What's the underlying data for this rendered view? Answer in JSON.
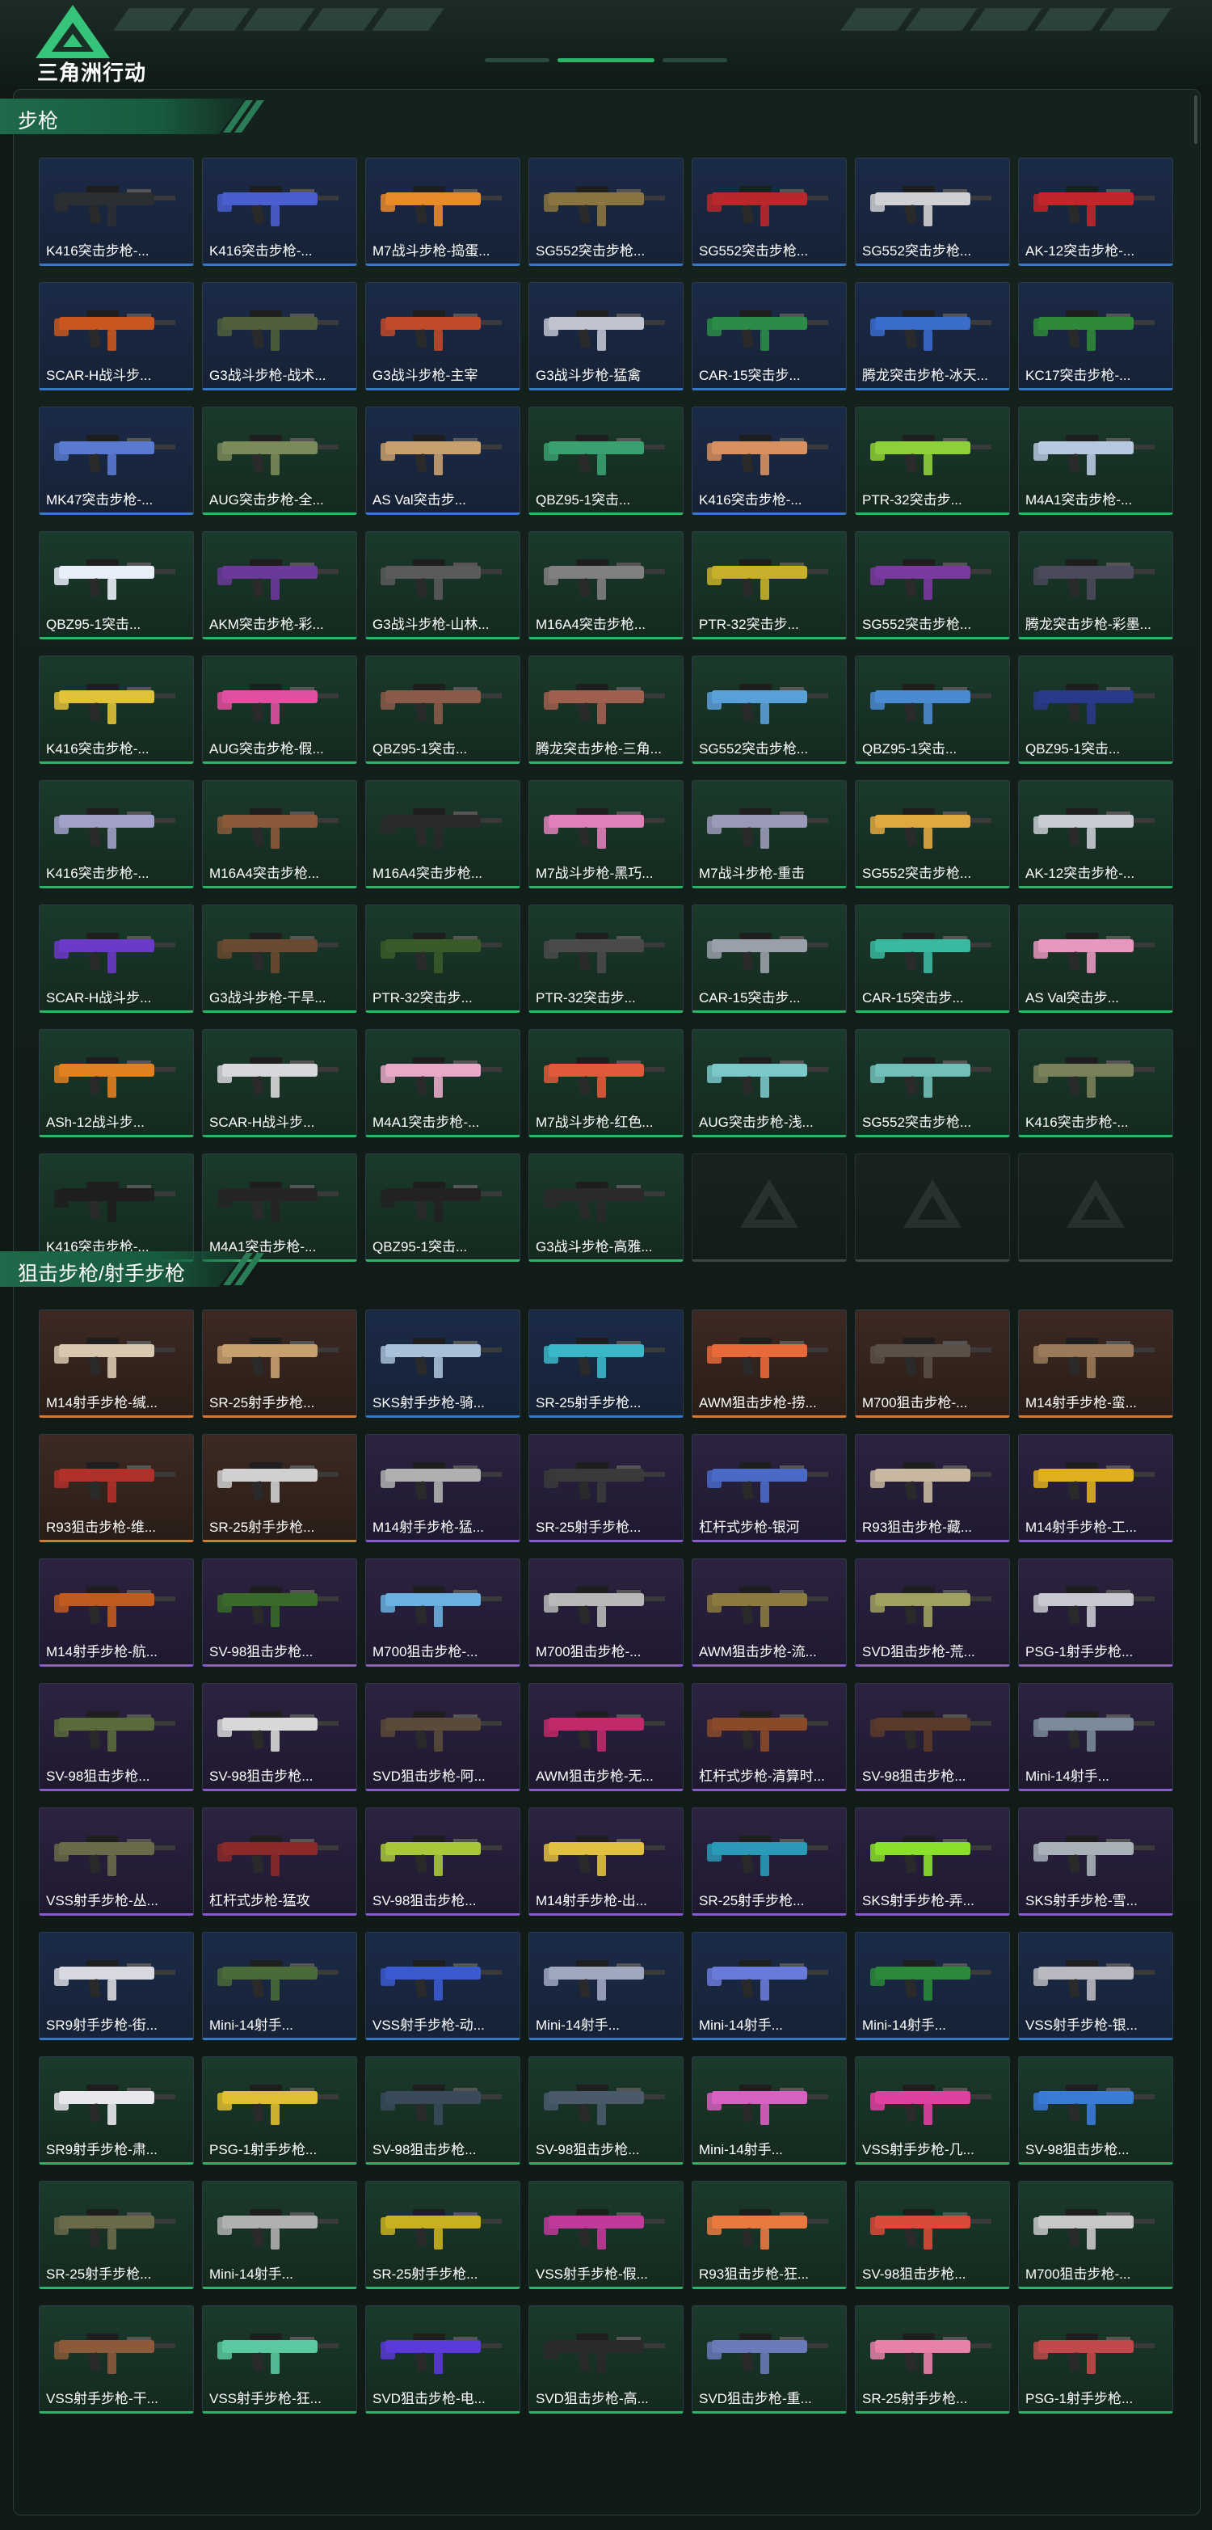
{
  "header": {
    "logo_text": "三角洲行动",
    "accent": "#2fb36a"
  },
  "sections": [
    {
      "title": "步枪",
      "items": [
        {
          "name": "K416突击步枪-...",
          "rarity": "blue",
          "color": "#2b2f33"
        },
        {
          "name": "K416突击步枪-...",
          "rarity": "blue",
          "color": "#4a5fcf"
        },
        {
          "name": "M7战斗步枪-捣蛋...",
          "rarity": "blue",
          "color": "#e88a2a"
        },
        {
          "name": "SG552突击步枪...",
          "rarity": "blue",
          "color": "#8a7440"
        },
        {
          "name": "SG552突击步枪...",
          "rarity": "blue",
          "color": "#b8282a"
        },
        {
          "name": "SG552突击步枪...",
          "rarity": "blue",
          "color": "#d0d0d4"
        },
        {
          "name": "AK-12突击步枪-...",
          "rarity": "blue",
          "color": "#c0262a"
        },
        {
          "name": "SCAR-H战斗步...",
          "rarity": "blue",
          "color": "#c8561e"
        },
        {
          "name": "G3战斗步枪-战术...",
          "rarity": "blue",
          "color": "#4f5f3c"
        },
        {
          "name": "G3战斗步枪-主宰",
          "rarity": "blue",
          "color": "#c04a2a"
        },
        {
          "name": "G3战斗步枪-猛禽",
          "rarity": "blue",
          "color": "#c0c4d0"
        },
        {
          "name": "CAR-15突击步...",
          "rarity": "blue",
          "color": "#2a8c48"
        },
        {
          "name": "腾龙突击步枪-冰天...",
          "rarity": "blue",
          "color": "#3a6ccc"
        },
        {
          "name": "KC17突击步枪-...",
          "rarity": "blue",
          "color": "#2e8a38"
        },
        {
          "name": "MK47突击步枪-...",
          "rarity": "blue",
          "color": "#5a7ad0"
        },
        {
          "name": "AUG突击步枪-全...",
          "rarity": "green",
          "color": "#7a8a5a"
        },
        {
          "name": "AS Val突击步...",
          "rarity": "blue",
          "color": "#c8a070"
        },
        {
          "name": "QBZ95-1突击...",
          "rarity": "green",
          "color": "#3aa070"
        },
        {
          "name": "K416突击步枪-...",
          "rarity": "blue",
          "color": "#d89060"
        },
        {
          "name": "PTR-32突击步...",
          "rarity": "green",
          "color": "#8ed03a"
        },
        {
          "name": "M4A1突击步枪-...",
          "rarity": "green",
          "color": "#b8c8e0"
        },
        {
          "name": "QBZ95-1突击...",
          "rarity": "green",
          "color": "#e8eef8"
        },
        {
          "name": "AKM突击步枪-彩...",
          "rarity": "green",
          "color": "#6a3a9a"
        },
        {
          "name": "G3战斗步枪-山林...",
          "rarity": "green",
          "color": "#5a5a5a"
        },
        {
          "name": "M16A4突击步枪...",
          "rarity": "green",
          "color": "#808080"
        },
        {
          "name": "PTR-32突击步...",
          "rarity": "green",
          "color": "#c8b02a"
        },
        {
          "name": "SG552突击步枪...",
          "rarity": "green",
          "color": "#7a3aa0"
        },
        {
          "name": "腾龙突击步枪-彩墨...",
          "rarity": "green",
          "color": "#4a4a5a"
        },
        {
          "name": "K416突击步枪-...",
          "rarity": "green",
          "color": "#e0c23a"
        },
        {
          "name": "AUG突击步枪-假...",
          "rarity": "green",
          "color": "#e050a0"
        },
        {
          "name": "QBZ95-1突击...",
          "rarity": "green",
          "color": "#8a5a4a"
        },
        {
          "name": "腾龙突击步枪-三角...",
          "rarity": "green",
          "color": "#a06050"
        },
        {
          "name": "SG552突击步枪...",
          "rarity": "green",
          "color": "#5aa0d8"
        },
        {
          "name": "QBZ95-1突击...",
          "rarity": "green",
          "color": "#4a8ad0"
        },
        {
          "name": "QBZ95-1突击...",
          "rarity": "green",
          "color": "#2a3a8a"
        },
        {
          "name": "K416突击步枪-...",
          "rarity": "green",
          "color": "#a0a0c8"
        },
        {
          "name": "M16A4突击步枪...",
          "rarity": "green",
          "color": "#8a5a3a"
        },
        {
          "name": "M16A4突击步枪...",
          "rarity": "green",
          "color": "#2a2a2a"
        },
        {
          "name": "M7战斗步枪-黑巧...",
          "rarity": "green",
          "color": "#e080b8"
        },
        {
          "name": "M7战斗步枪-重击",
          "rarity": "green",
          "color": "#9a9ab8"
        },
        {
          "name": "SG552突击步枪...",
          "rarity": "green",
          "color": "#e0a840"
        },
        {
          "name": "AK-12突击步枪-...",
          "rarity": "green",
          "color": "#c8ccd4"
        },
        {
          "name": "SCAR-H战斗步...",
          "rarity": "green",
          "color": "#6a3ac8"
        },
        {
          "name": "G3战斗步枪-干旱...",
          "rarity": "green",
          "color": "#6a4a30"
        },
        {
          "name": "PTR-32突击步...",
          "rarity": "green",
          "color": "#3a5a2a"
        },
        {
          "name": "PTR-32突击步...",
          "rarity": "green",
          "color": "#4a4a4a"
        },
        {
          "name": "CAR-15突击步...",
          "rarity": "green",
          "color": "#9aa0aa"
        },
        {
          "name": "CAR-15突击步...",
          "rarity": "green",
          "color": "#3ab8a0"
        },
        {
          "name": "AS Val突击步...",
          "rarity": "green",
          "color": "#e898c0"
        },
        {
          "name": "ASh-12战斗步...",
          "rarity": "green",
          "color": "#e08020"
        },
        {
          "name": "SCAR-H战斗步...",
          "rarity": "green",
          "color": "#d8d8dc"
        },
        {
          "name": "M4A1突击步枪-...",
          "rarity": "green",
          "color": "#e8a8c8"
        },
        {
          "name": "M7战斗步枪-红色...",
          "rarity": "green",
          "color": "#e05a3a"
        },
        {
          "name": "AUG突击步枪-浅...",
          "rarity": "green",
          "color": "#7ac8c8"
        },
        {
          "name": "SG552突击步枪...",
          "rarity": "green",
          "color": "#70c0b8"
        },
        {
          "name": "K416突击步枪-...",
          "rarity": "green",
          "color": "#7a805a"
        },
        {
          "name": "K416突击步枪-...",
          "rarity": "green",
          "color": "#1e1e1e"
        },
        {
          "name": "M4A1突击步枪-...",
          "rarity": "green",
          "color": "#252525"
        },
        {
          "name": "QBZ95-1突击...",
          "rarity": "green",
          "color": "#222222"
        },
        {
          "name": "G3战斗步枪-高雅...",
          "rarity": "green",
          "color": "#2a2a2a"
        },
        {
          "name": "",
          "rarity": "empty",
          "color": ""
        },
        {
          "name": "",
          "rarity": "empty",
          "color": ""
        },
        {
          "name": "",
          "rarity": "empty",
          "color": ""
        }
      ]
    },
    {
      "title": "狙击步枪/射手步枪",
      "items": [
        {
          "name": "M14射手步枪-缄...",
          "rarity": "gold",
          "color": "#d8c8b0"
        },
        {
          "name": "SR-25射手步枪...",
          "rarity": "gold",
          "color": "#c8a070"
        },
        {
          "name": "SKS射手步枪-骑...",
          "rarity": "blue",
          "color": "#a8c0d8"
        },
        {
          "name": "SR-25射手步枪...",
          "rarity": "blue",
          "color": "#3ab8c8"
        },
        {
          "name": "AWM狙击步枪-捞...",
          "rarity": "gold",
          "color": "#e86a3a"
        },
        {
          "name": "M700狙击步枪-...",
          "rarity": "gold",
          "color": "#5a5048"
        },
        {
          "name": "M14射手步枪-蛮...",
          "rarity": "gold",
          "color": "#9a7a5a"
        },
        {
          "name": "R93狙击步枪-维...",
          "rarity": "gold",
          "color": "#b0302a"
        },
        {
          "name": "SR-25射手步枪...",
          "rarity": "gold",
          "color": "#d0d0d0"
        },
        {
          "name": "M14射手步枪-猛...",
          "rarity": "purple",
          "color": "#b0b0b0"
        },
        {
          "name": "SR-25射手步枪...",
          "rarity": "purple",
          "color": "#3a3a3a"
        },
        {
          "name": "杠杆式步枪-银河",
          "rarity": "purple",
          "color": "#4a6ac8"
        },
        {
          "name": "R93狙击步枪-藏...",
          "rarity": "purple",
          "color": "#c8b8a0"
        },
        {
          "name": "M14射手步枪-工...",
          "rarity": "purple",
          "color": "#e0b020"
        },
        {
          "name": "M14射手步枪-航...",
          "rarity": "purple",
          "color": "#c05a20"
        },
        {
          "name": "SV-98狙击步枪...",
          "rarity": "purple",
          "color": "#3a6a2a"
        },
        {
          "name": "M700狙击步枪-...",
          "rarity": "purple",
          "color": "#6ab0e0"
        },
        {
          "name": "M700狙击步枪-...",
          "rarity": "purple",
          "color": "#b8b8b8"
        },
        {
          "name": "AWM狙击步枪-流...",
          "rarity": "purple",
          "color": "#8a7a40"
        },
        {
          "name": "SVD狙击步枪-荒...",
          "rarity": "purple",
          "color": "#a0a060"
        },
        {
          "name": "PSG-1射手步枪...",
          "rarity": "purple",
          "color": "#c8c8d0"
        },
        {
          "name": "SV-98狙击步枪...",
          "rarity": "purple",
          "color": "#5a6a3a"
        },
        {
          "name": "SV-98狙击步枪...",
          "rarity": "purple",
          "color": "#d8d8d8"
        },
        {
          "name": "SVD狙击步枪-阿...",
          "rarity": "purple",
          "color": "#5a4a3a"
        },
        {
          "name": "AWM狙击步枪-无...",
          "rarity": "purple",
          "color": "#c02a6a"
        },
        {
          "name": "杠杆式步枪-清算时...",
          "rarity": "purple",
          "color": "#8a4a2a"
        },
        {
          "name": "SV-98狙击步枪...",
          "rarity": "purple",
          "color": "#5a3a2a"
        },
        {
          "name": "Mini-14射手...",
          "rarity": "purple",
          "color": "#7a8a9a"
        },
        {
          "name": "VSS射手步枪-丛...",
          "rarity": "purple",
          "color": "#6a6a4a"
        },
        {
          "name": "杠杆式步枪-猛攻",
          "rarity": "purple",
          "color": "#8a2a2a"
        },
        {
          "name": "SV-98狙击步枪...",
          "rarity": "purple",
          "color": "#a8c83a"
        },
        {
          "name": "M14射手步枪-出...",
          "rarity": "purple",
          "color": "#e0c040"
        },
        {
          "name": "SR-25射手步枪...",
          "rarity": "purple",
          "color": "#2a9ab8"
        },
        {
          "name": "SKS射手步枪-弄...",
          "rarity": "purple",
          "color": "#8ae02a"
        },
        {
          "name": "SKS射手步枪-雪...",
          "rarity": "purple",
          "color": "#a8b0b8"
        },
        {
          "name": "SR9射手步枪-街...",
          "rarity": "blue",
          "color": "#d8d8e0"
        },
        {
          "name": "Mini-14射手...",
          "rarity": "blue",
          "color": "#4a6a3a"
        },
        {
          "name": "VSS射手步枪-动...",
          "rarity": "blue",
          "color": "#3a5ad0"
        },
        {
          "name": "Mini-14射手...",
          "rarity": "blue",
          "color": "#a0a8c0"
        },
        {
          "name": "Mini-14射手...",
          "rarity": "blue",
          "color": "#6a7ad8"
        },
        {
          "name": "Mini-14射手...",
          "rarity": "blue",
          "color": "#2a8a3a"
        },
        {
          "name": "VSS射手步枪-银...",
          "rarity": "blue",
          "color": "#b8b8c0"
        },
        {
          "name": "SR9射手步枪-肃...",
          "rarity": "green",
          "color": "#e8e8ec"
        },
        {
          "name": "PSG-1射手步枪...",
          "rarity": "green",
          "color": "#e0c030"
        },
        {
          "name": "SV-98狙击步枪...",
          "rarity": "green",
          "color": "#3a4a5a"
        },
        {
          "name": "SV-98狙击步枪...",
          "rarity": "green",
          "color": "#4a5a6a"
        },
        {
          "name": "Mini-14射手...",
          "rarity": "green",
          "color": "#d860c0"
        },
        {
          "name": "VSS射手步枪-几...",
          "rarity": "green",
          "color": "#e040a0"
        },
        {
          "name": "SV-98狙击步枪...",
          "rarity": "green",
          "color": "#3a7ad8"
        },
        {
          "name": "SR-25射手步枪...",
          "rarity": "green",
          "color": "#6a6a4a"
        },
        {
          "name": "Mini-14射手...",
          "rarity": "green",
          "color": "#b0b0b0"
        },
        {
          "name": "SR-25射手步枪...",
          "rarity": "green",
          "color": "#c8b020"
        },
        {
          "name": "VSS射手步枪-假...",
          "rarity": "green",
          "color": "#c03a9a"
        },
        {
          "name": "R93狙击步枪-狂...",
          "rarity": "green",
          "color": "#e87a40"
        },
        {
          "name": "SV-98狙击步枪...",
          "rarity": "green",
          "color": "#d84a3a"
        },
        {
          "name": "M700狙击步枪-...",
          "rarity": "green",
          "color": "#c8c8c8"
        },
        {
          "name": "VSS射手步枪-干...",
          "rarity": "green",
          "color": "#8a5a3a"
        },
        {
          "name": "VSS射手步枪-狂...",
          "rarity": "green",
          "color": "#5ac8a0"
        },
        {
          "name": "SVD狙击步枪-电...",
          "rarity": "green",
          "color": "#5a3ad8"
        },
        {
          "name": "SVD狙击步枪-高...",
          "rarity": "green",
          "color": "#2a2a2a"
        },
        {
          "name": "SVD狙击步枪-重...",
          "rarity": "green",
          "color": "#6a7ab8"
        },
        {
          "name": "SR-25射手步枪...",
          "rarity": "green",
          "color": "#e880a8"
        },
        {
          "name": "PSG-1射手步枪...",
          "rarity": "green",
          "color": "#c04a4a"
        }
      ]
    }
  ]
}
